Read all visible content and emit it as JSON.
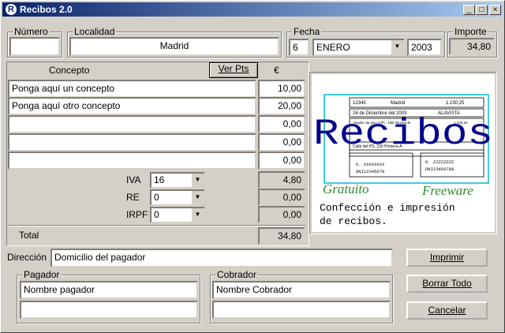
{
  "window": {
    "title": "Recibos 2.0",
    "app_icon_letter": "R"
  },
  "controls": {
    "minimize": "_",
    "maximize": "□",
    "close": "×"
  },
  "header": {
    "numero": {
      "label": "Número",
      "value": ""
    },
    "localidad": {
      "label": "Localidad",
      "value": "Madrid"
    },
    "fecha": {
      "label": "Fecha",
      "day": "6",
      "month": "ENERO",
      "year": "2003"
    },
    "importe": {
      "label": "Importe",
      "value": "34,80"
    }
  },
  "table": {
    "concepto_header": "Concepto",
    "ver_pts_label": "Ver Pts",
    "currency_header": "€",
    "rows": [
      {
        "concepto": "Ponga aquí un concepto",
        "amount": "10,00"
      },
      {
        "concepto": "Ponga aquí otro concepto",
        "amount": "20,00"
      },
      {
        "concepto": "",
        "amount": "0,00"
      },
      {
        "concepto": "",
        "amount": "0,00"
      },
      {
        "concepto": "",
        "amount": "0,00"
      }
    ],
    "taxes": [
      {
        "label": "IVA",
        "rate": "16",
        "amount": "4,80"
      },
      {
        "label": "RE",
        "rate": "0",
        "amount": "0,00"
      },
      {
        "label": "IRPF",
        "rate": "0",
        "amount": "0,00"
      }
    ],
    "total_label": "Total",
    "total_value": "34,80"
  },
  "logo_panel": {
    "title": "Recibos",
    "gratuito": "Gratuito",
    "freeware": "Freeware",
    "tagline_1": "Confección e impresión",
    "tagline_2": "de recibos.",
    "receipt": {
      "num": "12345",
      "city": "Madrid",
      "amount": "1.230,25",
      "date": "24 de Diciembre del 2003",
      "words": "ALAVISTA",
      "line_a": "Alquiler de piso C/Pl...18B Tercero-B",
      "line_a_amount": "1.230,25",
      "address": "Calle del PS, 230 Primera-A",
      "payer_name": "D. XXXXXXXX",
      "payer_dni": "DNI12345678",
      "collector_name": "D. ZZZZZZZZ",
      "collector_dni": "DNI23456789"
    }
  },
  "direccion": {
    "label": "Dirección",
    "value": "Domicilio del pagador"
  },
  "pagador": {
    "label": "Pagador",
    "name": "Nombre pagador",
    "dni": ""
  },
  "cobrador": {
    "label": "Cobrador",
    "name": "Nombre Cobrador",
    "dni": ""
  },
  "buttons": {
    "imprimir": "Imprimir",
    "borrar": "Borrar Todo",
    "cancelar": "Cancelar"
  },
  "colors": {
    "title_blue": "#0a246a",
    "logo_blue": "#00008b",
    "logo_green": "#2e8b2e",
    "face": "#d4d0c8"
  }
}
